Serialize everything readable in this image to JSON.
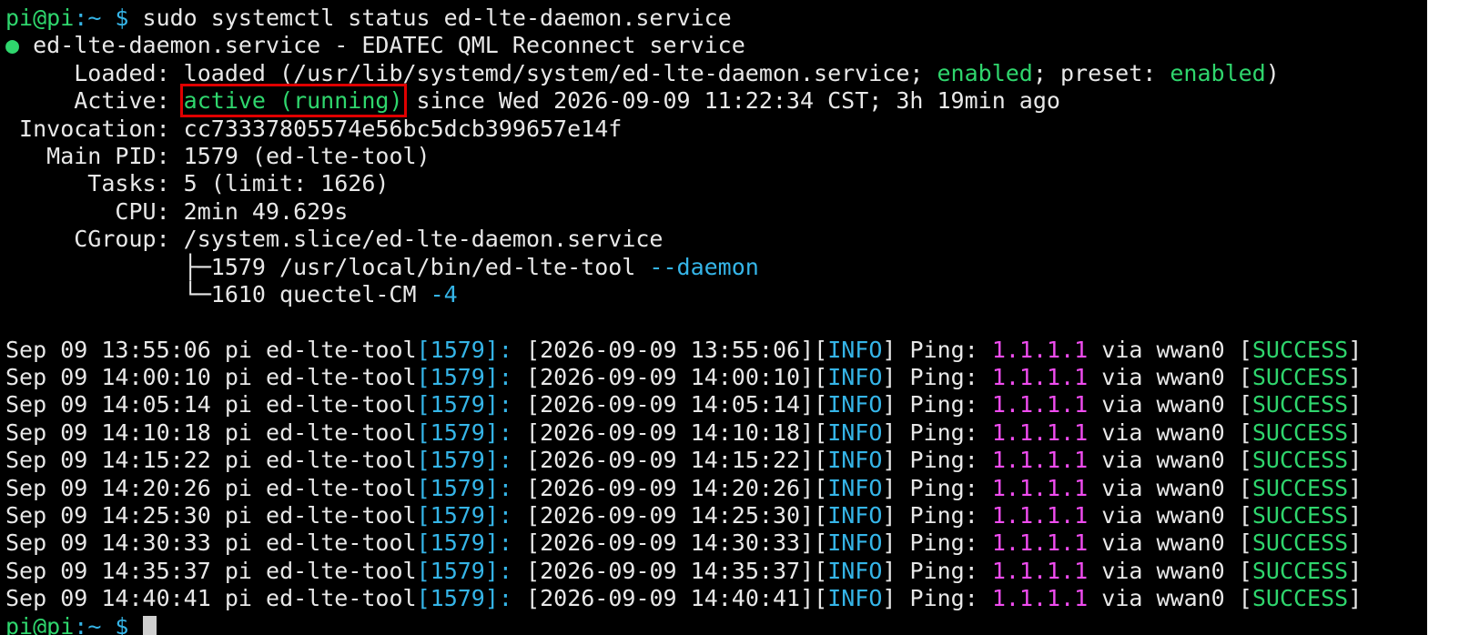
{
  "prompt": {
    "user": "pi@pi",
    "path": ":~",
    "symbol": " $ ",
    "command": "sudo systemctl status ed-lte-daemon.service"
  },
  "status": {
    "dot": "●",
    "title": " ed-lte-daemon.service - EDATEC QML Reconnect service",
    "loaded_label": "     Loaded: ",
    "loaded_prefix": "loaded (/usr/lib/systemd/system/ed-lte-daemon.service; ",
    "loaded_enabled": "enabled",
    "loaded_mid": "; preset: ",
    "loaded_preset": "enabled",
    "loaded_suffix": ")",
    "active_label": "     Active: ",
    "active_state": "active (running)",
    "active_since": " since Wed 2026-09-09 11:22:34 CST; 3h 19min ago",
    "invocation_label": " Invocation: ",
    "invocation_value": "cc73337805574e56bc5dcb399657e14f",
    "pid_label": "   Main PID: ",
    "pid_value": "1579 (ed-lte-tool)",
    "tasks_label": "      Tasks: ",
    "tasks_value": "5 (limit: 1626)",
    "cpu_label": "        CPU: ",
    "cpu_value": "2min 49.629s",
    "cgroup_label": "     CGroup: ",
    "cgroup_value": "/system.slice/ed-lte-daemon.service",
    "tree1_prefix": "             ├─1579 /usr/local/bin/ed-lte-tool ",
    "tree1_flag": "--daemon",
    "tree2_prefix": "             └─1610 quectel-CM ",
    "tree2_flag": "-4"
  },
  "logs": [
    {
      "ts": "Sep 09 13:55:06",
      "host": "pi",
      "proc": "ed-lte-tool",
      "pid": "1579",
      "dt": "2026-09-09 13:55:06",
      "level": "INFO",
      "msg": "Ping:",
      "ip": "1.1.1.1",
      "via": "via wwan0",
      "result": "SUCCESS"
    },
    {
      "ts": "Sep 09 14:00:10",
      "host": "pi",
      "proc": "ed-lte-tool",
      "pid": "1579",
      "dt": "2026-09-09 14:00:10",
      "level": "INFO",
      "msg": "Ping:",
      "ip": "1.1.1.1",
      "via": "via wwan0",
      "result": "SUCCESS"
    },
    {
      "ts": "Sep 09 14:05:14",
      "host": "pi",
      "proc": "ed-lte-tool",
      "pid": "1579",
      "dt": "2026-09-09 14:05:14",
      "level": "INFO",
      "msg": "Ping:",
      "ip": "1.1.1.1",
      "via": "via wwan0",
      "result": "SUCCESS"
    },
    {
      "ts": "Sep 09 14:10:18",
      "host": "pi",
      "proc": "ed-lte-tool",
      "pid": "1579",
      "dt": "2026-09-09 14:10:18",
      "level": "INFO",
      "msg": "Ping:",
      "ip": "1.1.1.1",
      "via": "via wwan0",
      "result": "SUCCESS"
    },
    {
      "ts": "Sep 09 14:15:22",
      "host": "pi",
      "proc": "ed-lte-tool",
      "pid": "1579",
      "dt": "2026-09-09 14:15:22",
      "level": "INFO",
      "msg": "Ping:",
      "ip": "1.1.1.1",
      "via": "via wwan0",
      "result": "SUCCESS"
    },
    {
      "ts": "Sep 09 14:20:26",
      "host": "pi",
      "proc": "ed-lte-tool",
      "pid": "1579",
      "dt": "2026-09-09 14:20:26",
      "level": "INFO",
      "msg": "Ping:",
      "ip": "1.1.1.1",
      "via": "via wwan0",
      "result": "SUCCESS"
    },
    {
      "ts": "Sep 09 14:25:30",
      "host": "pi",
      "proc": "ed-lte-tool",
      "pid": "1579",
      "dt": "2026-09-09 14:25:30",
      "level": "INFO",
      "msg": "Ping:",
      "ip": "1.1.1.1",
      "via": "via wwan0",
      "result": "SUCCESS"
    },
    {
      "ts": "Sep 09 14:30:33",
      "host": "pi",
      "proc": "ed-lte-tool",
      "pid": "1579",
      "dt": "2026-09-09 14:30:33",
      "level": "INFO",
      "msg": "Ping:",
      "ip": "1.1.1.1",
      "via": "via wwan0",
      "result": "SUCCESS"
    },
    {
      "ts": "Sep 09 14:35:37",
      "host": "pi",
      "proc": "ed-lte-tool",
      "pid": "1579",
      "dt": "2026-09-09 14:35:37",
      "level": "INFO",
      "msg": "Ping:",
      "ip": "1.1.1.1",
      "via": "via wwan0",
      "result": "SUCCESS"
    },
    {
      "ts": "Sep 09 14:40:41",
      "host": "pi",
      "proc": "ed-lte-tool",
      "pid": "1579",
      "dt": "2026-09-09 14:40:41",
      "level": "INFO",
      "msg": "Ping:",
      "ip": "1.1.1.1",
      "via": "via wwan0",
      "result": "SUCCESS"
    }
  ],
  "final_prompt": {
    "user": "pi@pi",
    "path": ":~",
    "symbol": " $ "
  },
  "colors": {
    "background": "#000000",
    "text": "#e8e8e8",
    "green": "#2fd66d",
    "cyan": "#35b5e8",
    "magenta": "#f04cf0",
    "highlight_box": "#e00000"
  }
}
